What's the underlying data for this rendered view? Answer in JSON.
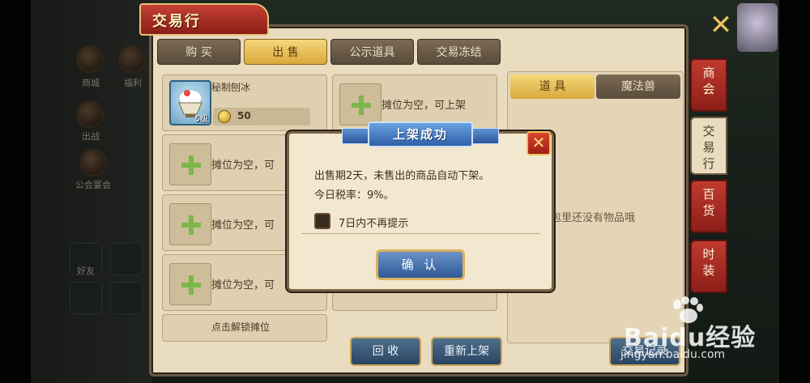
{
  "window": {
    "title": "交易行"
  },
  "tabs": [
    {
      "label": "购 买"
    },
    {
      "label": "出 售"
    },
    {
      "label": "公示道具"
    },
    {
      "label": "交易冻结"
    }
  ],
  "listed_item": {
    "name": "秘制刨冰",
    "level": "5级",
    "price": "50"
  },
  "slots": {
    "empty_label": "摊位为空，可上架",
    "empty_label_short": "摊位为空，可",
    "unlock_label": "点击解锁摊位"
  },
  "bag": {
    "tabs": [
      {
        "label": "道 具"
      },
      {
        "label": "魔法兽"
      }
    ],
    "empty_text": "包里还没有物品哦"
  },
  "side_tabs": [
    {
      "label": "商\n会"
    },
    {
      "label": "交\n易\n行"
    },
    {
      "label": "百\n货"
    },
    {
      "label": "时\n装"
    }
  ],
  "bottom_buttons": {
    "recycle": "回 收",
    "relist": "重新上架",
    "records": "交易记录"
  },
  "modal": {
    "title": "上架成功",
    "message1": "出售期2天，未售出的商品自动下架。",
    "message2": "今日税率：9%。",
    "checkbox_label": "7日内不再提示",
    "checkbox_checked": false,
    "confirm_label": "确 认"
  },
  "hud": {
    "left_labels": [
      "商城",
      "福利",
      "出战",
      "好友"
    ],
    "guild_text": "公会宴会"
  },
  "watermark": {
    "logo": "Baidu经验",
    "url": "jingyan.baidu.com"
  },
  "colors": {
    "panel_bg": "#e9dcbf",
    "active_tab": "#d9a93b",
    "confirm_button": "#2f5a96",
    "side_tab_red": "#c03a30"
  }
}
